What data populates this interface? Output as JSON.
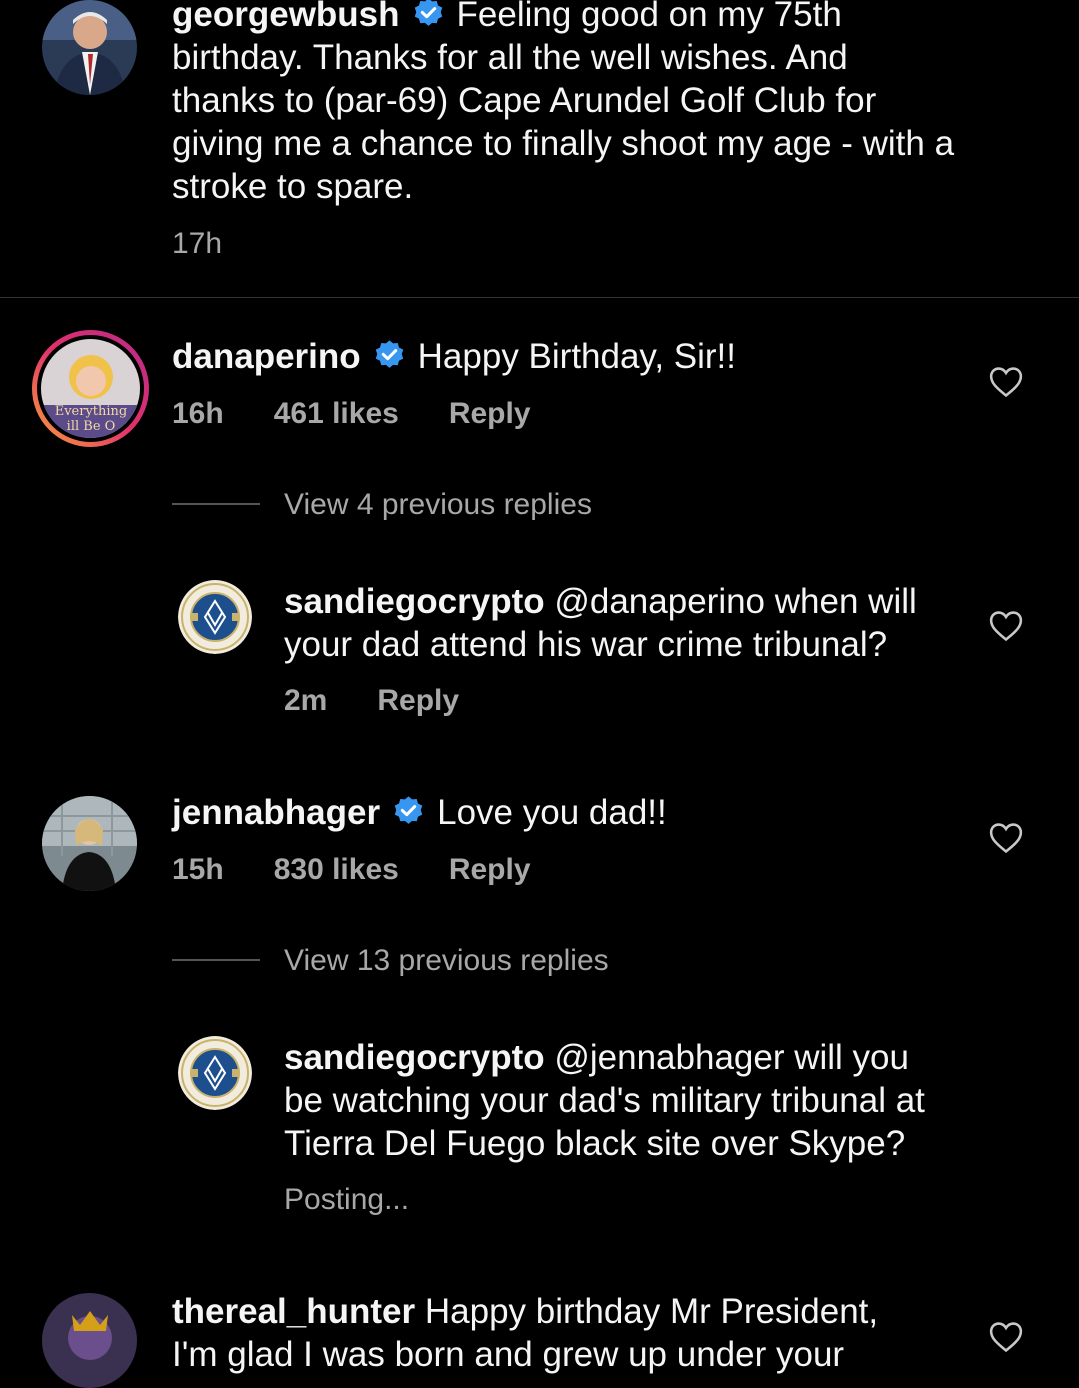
{
  "colors": {
    "background": "#000000",
    "text": "#f5f5f5",
    "muted": "#a8a8a8",
    "verified": "#3797f0"
  },
  "caption": {
    "username": "georgewbush",
    "verified": true,
    "text_line1": "Feeling good on my 75th",
    "text_rest": [
      "birthday. Thanks for all the well wishes. And",
      "thanks to (par-69) Cape Arundel Golf Club for",
      "giving me a chance to finally shoot my age - with a",
      "stroke to spare."
    ],
    "time": "17h"
  },
  "comments": [
    {
      "username": "danaperino",
      "verified": true,
      "text": "Happy Birthday, Sir!!",
      "time": "16h",
      "likes": "461 likes",
      "reply_label": "Reply",
      "avatar_text": [
        "Everything",
        "ill Be O"
      ],
      "view_replies": "View 4 previous replies",
      "reply": {
        "username": "sandiegocrypto",
        "mention": "@danaperino",
        "text_line1": "when will",
        "text_rest": [
          "your dad attend his war crime tribunal?"
        ],
        "time": "2m",
        "reply_label": "Reply"
      }
    },
    {
      "username": "jennabhager",
      "verified": true,
      "text": "Love you dad!!",
      "time": "15h",
      "likes": "830 likes",
      "reply_label": "Reply",
      "view_replies": "View 13 previous replies",
      "reply": {
        "username": "sandiegocrypto",
        "mention": "@jennabhager",
        "text_line1": "will you",
        "text_rest": [
          "be watching your dad's military tribunal at",
          "Tierra Del Fuego black site over Skype?"
        ],
        "status": "Posting..."
      }
    },
    {
      "username": "thereal_hunter",
      "text": "Happy birthday Mr President,",
      "text_rest": [
        "I'm glad I was born and grew up under your"
      ]
    }
  ]
}
